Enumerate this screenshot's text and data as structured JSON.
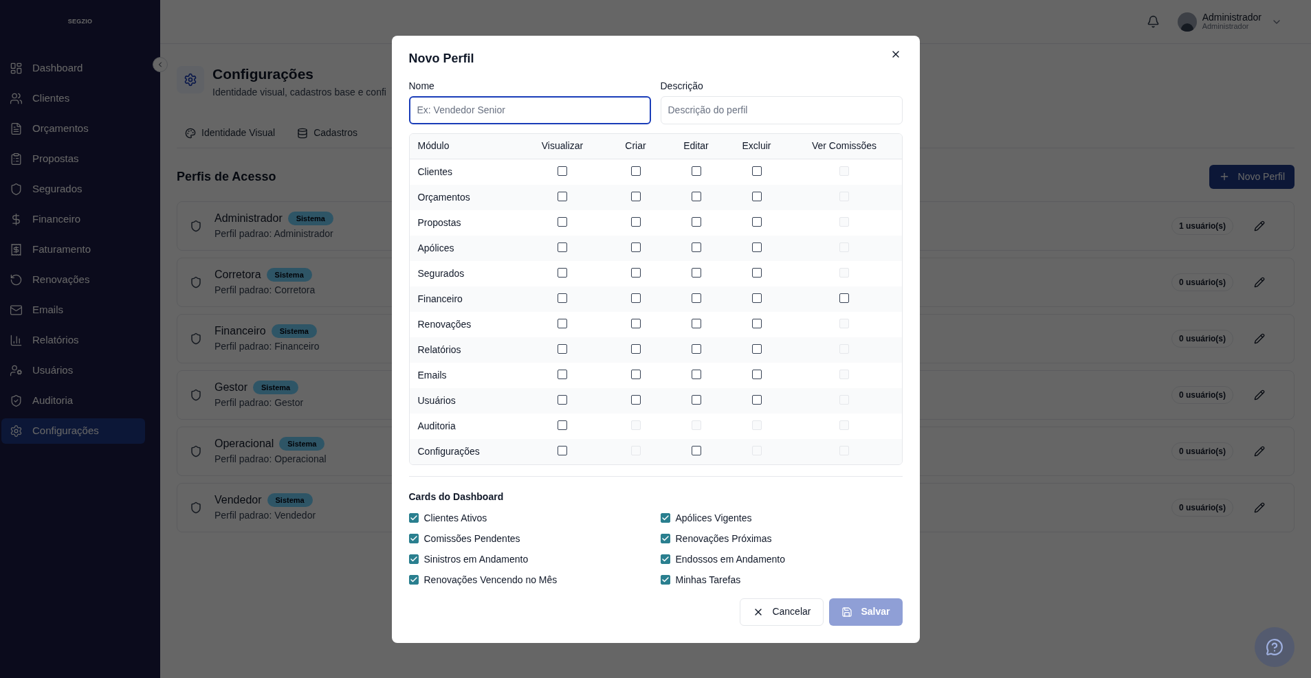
{
  "sidebar": {
    "brand": "SEGZIO",
    "items": [
      {
        "label": "Dashboard",
        "selected": false
      },
      {
        "label": "Clientes",
        "selected": false
      },
      {
        "label": "Orçamentos",
        "selected": false
      },
      {
        "label": "Propostas",
        "selected": false
      },
      {
        "label": "Segurados",
        "selected": false
      },
      {
        "label": "Financeiro",
        "selected": false
      },
      {
        "label": "Faturamento",
        "selected": false
      },
      {
        "label": "Renovações",
        "selected": false
      },
      {
        "label": "Emails",
        "selected": false
      },
      {
        "label": "Relatórios",
        "selected": false
      },
      {
        "label": "Usuários",
        "selected": false
      },
      {
        "label": "Auditoria",
        "selected": false
      },
      {
        "label": "Configurações",
        "selected": true
      }
    ]
  },
  "header": {
    "user": {
      "name": "Administrador",
      "role": "Administrador"
    }
  },
  "page": {
    "title": "Configurações",
    "subtitle": "Identidade visual, cadastros base e confi",
    "tabs": [
      {
        "label": "Identidade Visual",
        "selected": false
      },
      {
        "label": "Cadastros",
        "selected": false
      }
    ],
    "section_title": "Perfis de Acesso",
    "new_button": "Novo Perfil",
    "profiles": [
      {
        "name": "Administrador",
        "badge": "Sistema",
        "description": "Perfil padrao: Administrador",
        "users": "1 usuário(s)"
      },
      {
        "name": "Corretora",
        "badge": "Sistema",
        "description": "Perfil padrao: Corretora",
        "users": "0 usuário(s)"
      },
      {
        "name": "Financeiro",
        "badge": "Sistema",
        "description": "Perfil padrao: Financeiro",
        "users": "0 usuário(s)"
      },
      {
        "name": "Gestor",
        "badge": "Sistema",
        "description": "Perfil padrao: Gestor",
        "users": "0 usuário(s)"
      },
      {
        "name": "Operacional",
        "badge": "Sistema",
        "description": "Perfil padrao: Operacional",
        "users": "0 usuário(s)"
      },
      {
        "name": "Vendedor",
        "badge": "Sistema",
        "description": "Perfil padrao: Vendedor",
        "users": "0 usuário(s)"
      }
    ]
  },
  "modal": {
    "title": "Novo Perfil",
    "fields": [
      {
        "label": "Nome",
        "placeholder": "Ex: Vendedor Senior",
        "focused": true
      },
      {
        "label": "Descrição",
        "placeholder": "Descrição do perfil",
        "focused": false
      }
    ],
    "table": {
      "columns": [
        "Módulo",
        "Visualizar",
        "Criar",
        "Editar",
        "Excluir",
        "Ver Comissões"
      ],
      "rows": [
        {
          "module": "Clientes",
          "permissions": [
            {
              "checked": false,
              "disabled": false
            },
            {
              "checked": false,
              "disabled": false
            },
            {
              "checked": false,
              "disabled": false
            },
            {
              "checked": false,
              "disabled": false
            },
            {
              "checked": false,
              "disabled": true
            }
          ]
        },
        {
          "module": "Orçamentos",
          "permissions": [
            {
              "checked": false,
              "disabled": false
            },
            {
              "checked": false,
              "disabled": false
            },
            {
              "checked": false,
              "disabled": false
            },
            {
              "checked": false,
              "disabled": false
            },
            {
              "checked": false,
              "disabled": true
            }
          ]
        },
        {
          "module": "Propostas",
          "permissions": [
            {
              "checked": false,
              "disabled": false
            },
            {
              "checked": false,
              "disabled": false
            },
            {
              "checked": false,
              "disabled": false
            },
            {
              "checked": false,
              "disabled": false
            },
            {
              "checked": false,
              "disabled": true
            }
          ]
        },
        {
          "module": "Apólices",
          "permissions": [
            {
              "checked": false,
              "disabled": false
            },
            {
              "checked": false,
              "disabled": false
            },
            {
              "checked": false,
              "disabled": false
            },
            {
              "checked": false,
              "disabled": false
            },
            {
              "checked": false,
              "disabled": true
            }
          ]
        },
        {
          "module": "Segurados",
          "permissions": [
            {
              "checked": false,
              "disabled": false
            },
            {
              "checked": false,
              "disabled": false
            },
            {
              "checked": false,
              "disabled": false
            },
            {
              "checked": false,
              "disabled": false
            },
            {
              "checked": false,
              "disabled": true
            }
          ]
        },
        {
          "module": "Financeiro",
          "permissions": [
            {
              "checked": false,
              "disabled": false
            },
            {
              "checked": false,
              "disabled": false
            },
            {
              "checked": false,
              "disabled": false
            },
            {
              "checked": false,
              "disabled": false
            },
            {
              "checked": false,
              "disabled": false
            }
          ]
        },
        {
          "module": "Renovações",
          "permissions": [
            {
              "checked": false,
              "disabled": false
            },
            {
              "checked": false,
              "disabled": false
            },
            {
              "checked": false,
              "disabled": false
            },
            {
              "checked": false,
              "disabled": false
            },
            {
              "checked": false,
              "disabled": true
            }
          ]
        },
        {
          "module": "Relatórios",
          "permissions": [
            {
              "checked": false,
              "disabled": false
            },
            {
              "checked": false,
              "disabled": false
            },
            {
              "checked": false,
              "disabled": false
            },
            {
              "checked": false,
              "disabled": false
            },
            {
              "checked": false,
              "disabled": true
            }
          ]
        },
        {
          "module": "Emails",
          "permissions": [
            {
              "checked": false,
              "disabled": false
            },
            {
              "checked": false,
              "disabled": false
            },
            {
              "checked": false,
              "disabled": false
            },
            {
              "checked": false,
              "disabled": false
            },
            {
              "checked": false,
              "disabled": true
            }
          ]
        },
        {
          "module": "Usuários",
          "permissions": [
            {
              "checked": false,
              "disabled": false
            },
            {
              "checked": false,
              "disabled": false
            },
            {
              "checked": false,
              "disabled": false
            },
            {
              "checked": false,
              "disabled": false
            },
            {
              "checked": false,
              "disabled": true
            }
          ]
        },
        {
          "module": "Auditoria",
          "permissions": [
            {
              "checked": false,
              "disabled": false
            },
            {
              "checked": false,
              "disabled": true
            },
            {
              "checked": false,
              "disabled": true
            },
            {
              "checked": false,
              "disabled": true
            },
            {
              "checked": false,
              "disabled": true
            }
          ]
        },
        {
          "module": "Configurações",
          "permissions": [
            {
              "checked": false,
              "disabled": false
            },
            {
              "checked": false,
              "disabled": true
            },
            {
              "checked": false,
              "disabled": false
            },
            {
              "checked": false,
              "disabled": true
            },
            {
              "checked": false,
              "disabled": true
            }
          ]
        }
      ]
    },
    "cards_title": "Cards do Dashboard",
    "cards": [
      {
        "label": "Clientes Ativos",
        "checked": true
      },
      {
        "label": "Apólices Vigentes",
        "checked": true
      },
      {
        "label": "Comissões Pendentes",
        "checked": true
      },
      {
        "label": "Renovações Próximas",
        "checked": true
      },
      {
        "label": "Sinistros em Andamento",
        "checked": true
      },
      {
        "label": "Endossos em Andamento",
        "checked": true
      },
      {
        "label": "Renovações Vencendo no Mês",
        "checked": true
      },
      {
        "label": "Minhas Tarefas",
        "checked": true
      }
    ],
    "cancel": "Cancelar",
    "save": {
      "label": "Salvar",
      "disabled": true
    }
  }
}
